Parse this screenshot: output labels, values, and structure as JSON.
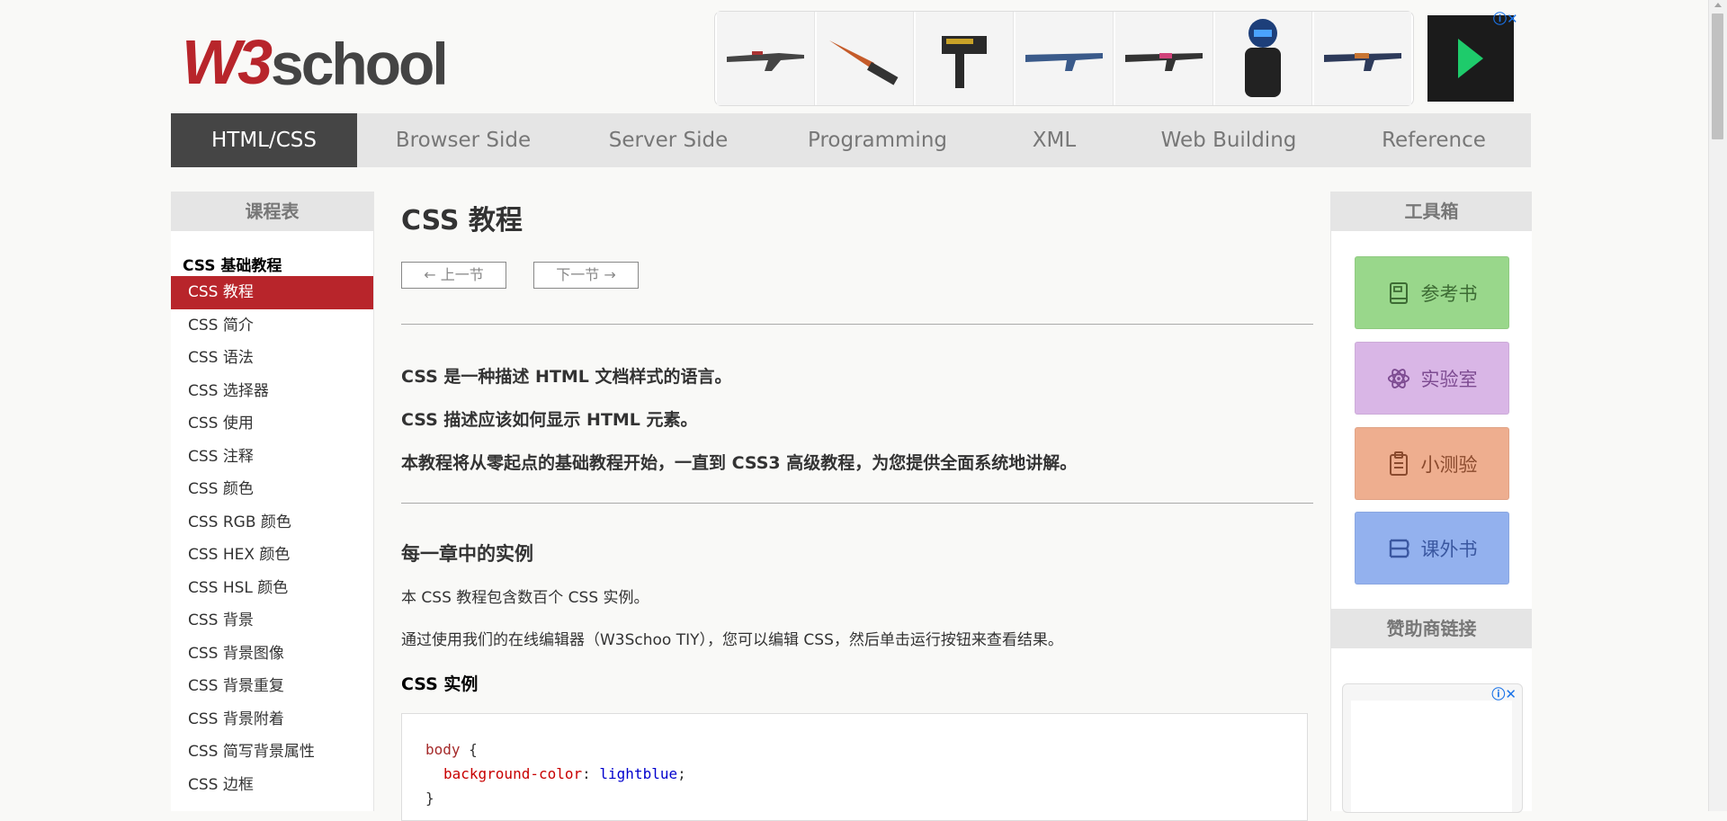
{
  "header": {
    "logo_w3": "W3",
    "logo_school": "school",
    "ad_close": "ⓘ✕"
  },
  "topnav": [
    {
      "label": "HTML/CSS",
      "active": true
    },
    {
      "label": "Browser Side"
    },
    {
      "label": "Server Side"
    },
    {
      "label": "Programming"
    },
    {
      "label": "XML"
    },
    {
      "label": "Web Building"
    },
    {
      "label": "Reference"
    }
  ],
  "left": {
    "title": "课程表",
    "group": "CSS 基础教程",
    "items": [
      "CSS 教程",
      "CSS 简介",
      "CSS 语法",
      "CSS 选择器",
      "CSS 使用",
      "CSS 注释",
      "CSS 颜色",
      "CSS RGB 颜色",
      "CSS HEX 颜色",
      "CSS HSL 颜色",
      "CSS 背景",
      "CSS 背景图像",
      "CSS 背景重复",
      "CSS 背景附着",
      "CSS 简写背景属性",
      "CSS 边框"
    ]
  },
  "main": {
    "title": "CSS 教程",
    "prev": "上一节",
    "next": "下一节",
    "intro": [
      "CSS 是一种描述 HTML 文档样式的语言。",
      "CSS 描述应该如何显示 HTML 元素。",
      "本教程将从零起点的基础教程开始，一直到 CSS3 高级教程，为您提供全面系统地讲解。"
    ],
    "section_title": "每一章中的实例",
    "section_p1": "本 CSS 教程包含数百个 CSS 实例。",
    "section_p2": "通过使用我们的在线编辑器（W3Schoo TIY），您可以编辑 CSS，然后单击运行按钮来查看结果。",
    "example_title": "CSS 实例",
    "code": {
      "selector": "body",
      "open": "{",
      "prop": "background-color",
      "colon": ":",
      "value": "lightblue",
      "semi": ";",
      "close": "}"
    }
  },
  "right": {
    "title": "工具箱",
    "tools": [
      "参考书",
      "实验室",
      "小测验",
      "课外书"
    ],
    "sponsor_title": "赞助商链接",
    "sponsor_close": "ⓘ✕"
  },
  "icons": {
    "book": "book-icon",
    "atom": "atom-icon",
    "clipboard": "clipboard-icon",
    "books": "books-icon"
  }
}
